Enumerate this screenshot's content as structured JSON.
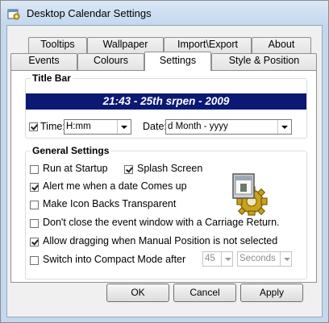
{
  "window": {
    "title": "Desktop Calendar Settings",
    "icon": "calendar-gear-icon"
  },
  "tabs": {
    "row_back": [
      "Tooltips",
      "Wallpaper",
      "Import\\Export",
      "About"
    ],
    "row_front": [
      "Events",
      "Colours",
      "Settings",
      "Style & Position"
    ],
    "active": "Settings"
  },
  "title_bar_group": {
    "legend": "Title Bar",
    "banner_text": "21:43 - 25th srpen - 2009",
    "banner_color": "#0b1973",
    "time_checked": true,
    "time_label": "Time:",
    "time_format": "H:mm",
    "date_label": "Date:",
    "date_format": "d Month - yyyy"
  },
  "general_group": {
    "legend": "General Settings",
    "options": [
      {
        "label": "Run at Startup",
        "checked": false
      },
      {
        "label": "Splash Screen",
        "checked": true
      },
      {
        "label": "Alert me when a date Comes up",
        "checked": true
      },
      {
        "label": "Make Icon Backs Transparent",
        "checked": false
      },
      {
        "label": "Don't close the event window with a Carriage Return.",
        "checked": false
      },
      {
        "label": "Allow dragging when Manual Position is not selected",
        "checked": true
      },
      {
        "label": "Switch into Compact Mode after",
        "checked": false
      }
    ],
    "compact_value": "45",
    "compact_unit": "Seconds",
    "illustration_icon": "gear-calendar-icon"
  },
  "buttons": {
    "ok": "OK",
    "cancel": "Cancel",
    "apply": "Apply"
  }
}
